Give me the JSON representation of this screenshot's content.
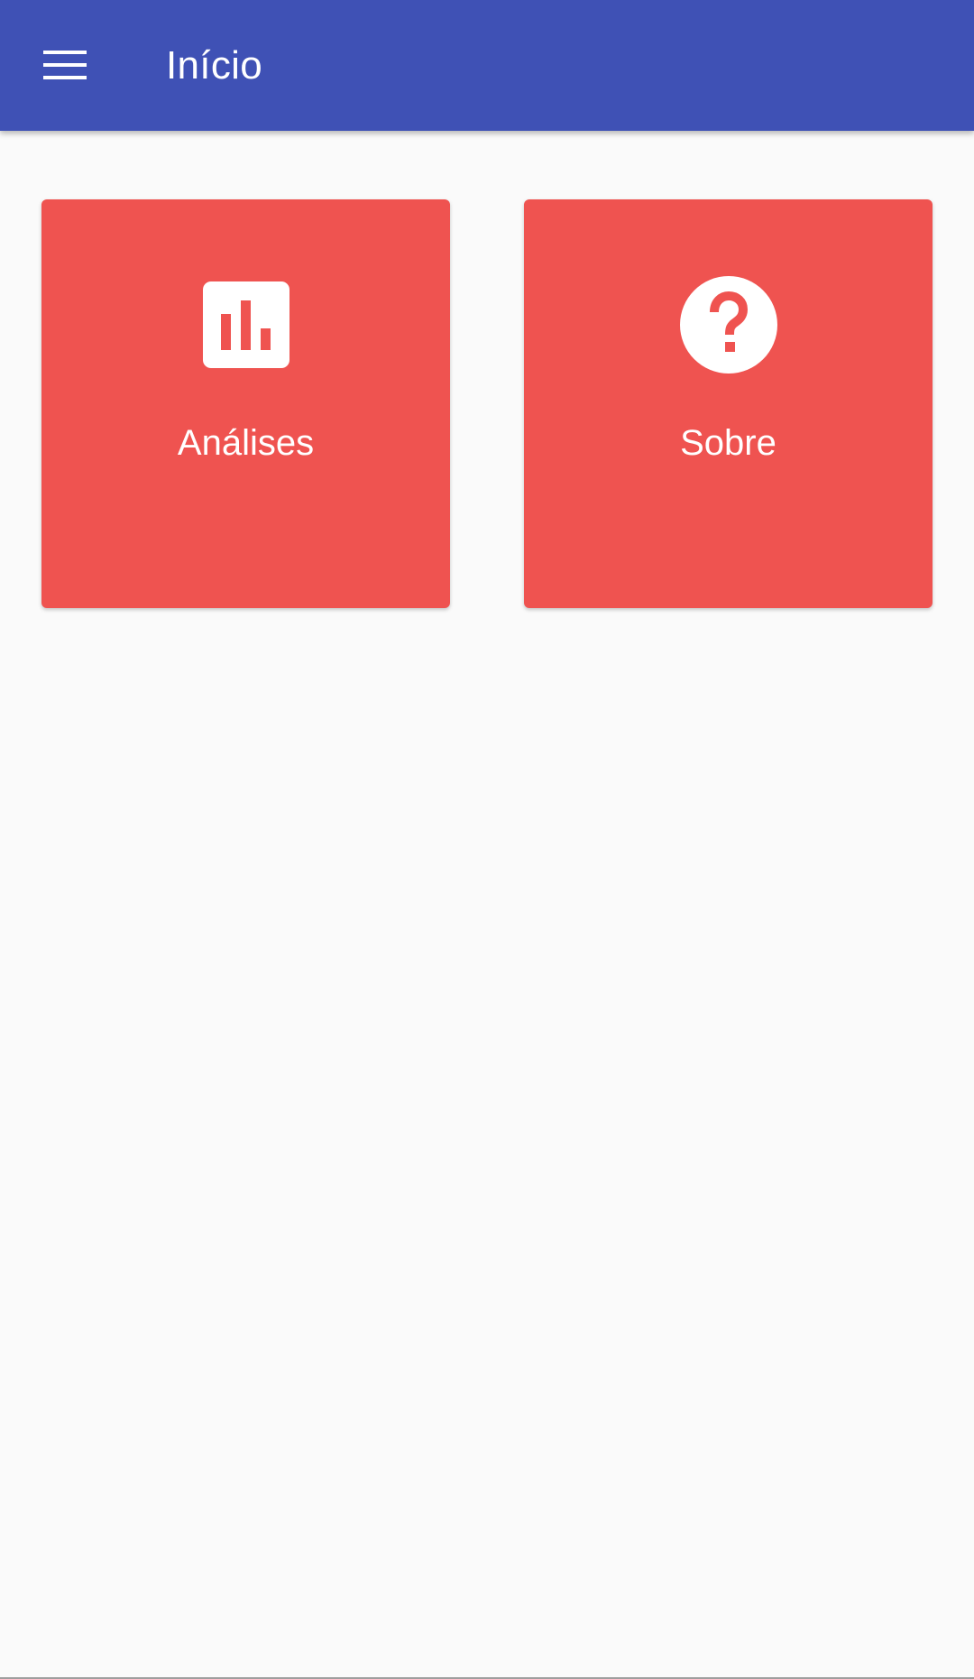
{
  "app_bar": {
    "title": "Início",
    "background_color": "#3f51b5",
    "menu_icon": "hamburger-menu-icon"
  },
  "tiles": [
    {
      "label": "Análises",
      "icon": "bar-chart-icon",
      "color": "#ef5350"
    },
    {
      "label": "Sobre",
      "icon": "help-circle-icon",
      "color": "#ef5350"
    }
  ],
  "colors": {
    "page_background": "#fafafa",
    "tile_foreground": "#ffffff"
  }
}
